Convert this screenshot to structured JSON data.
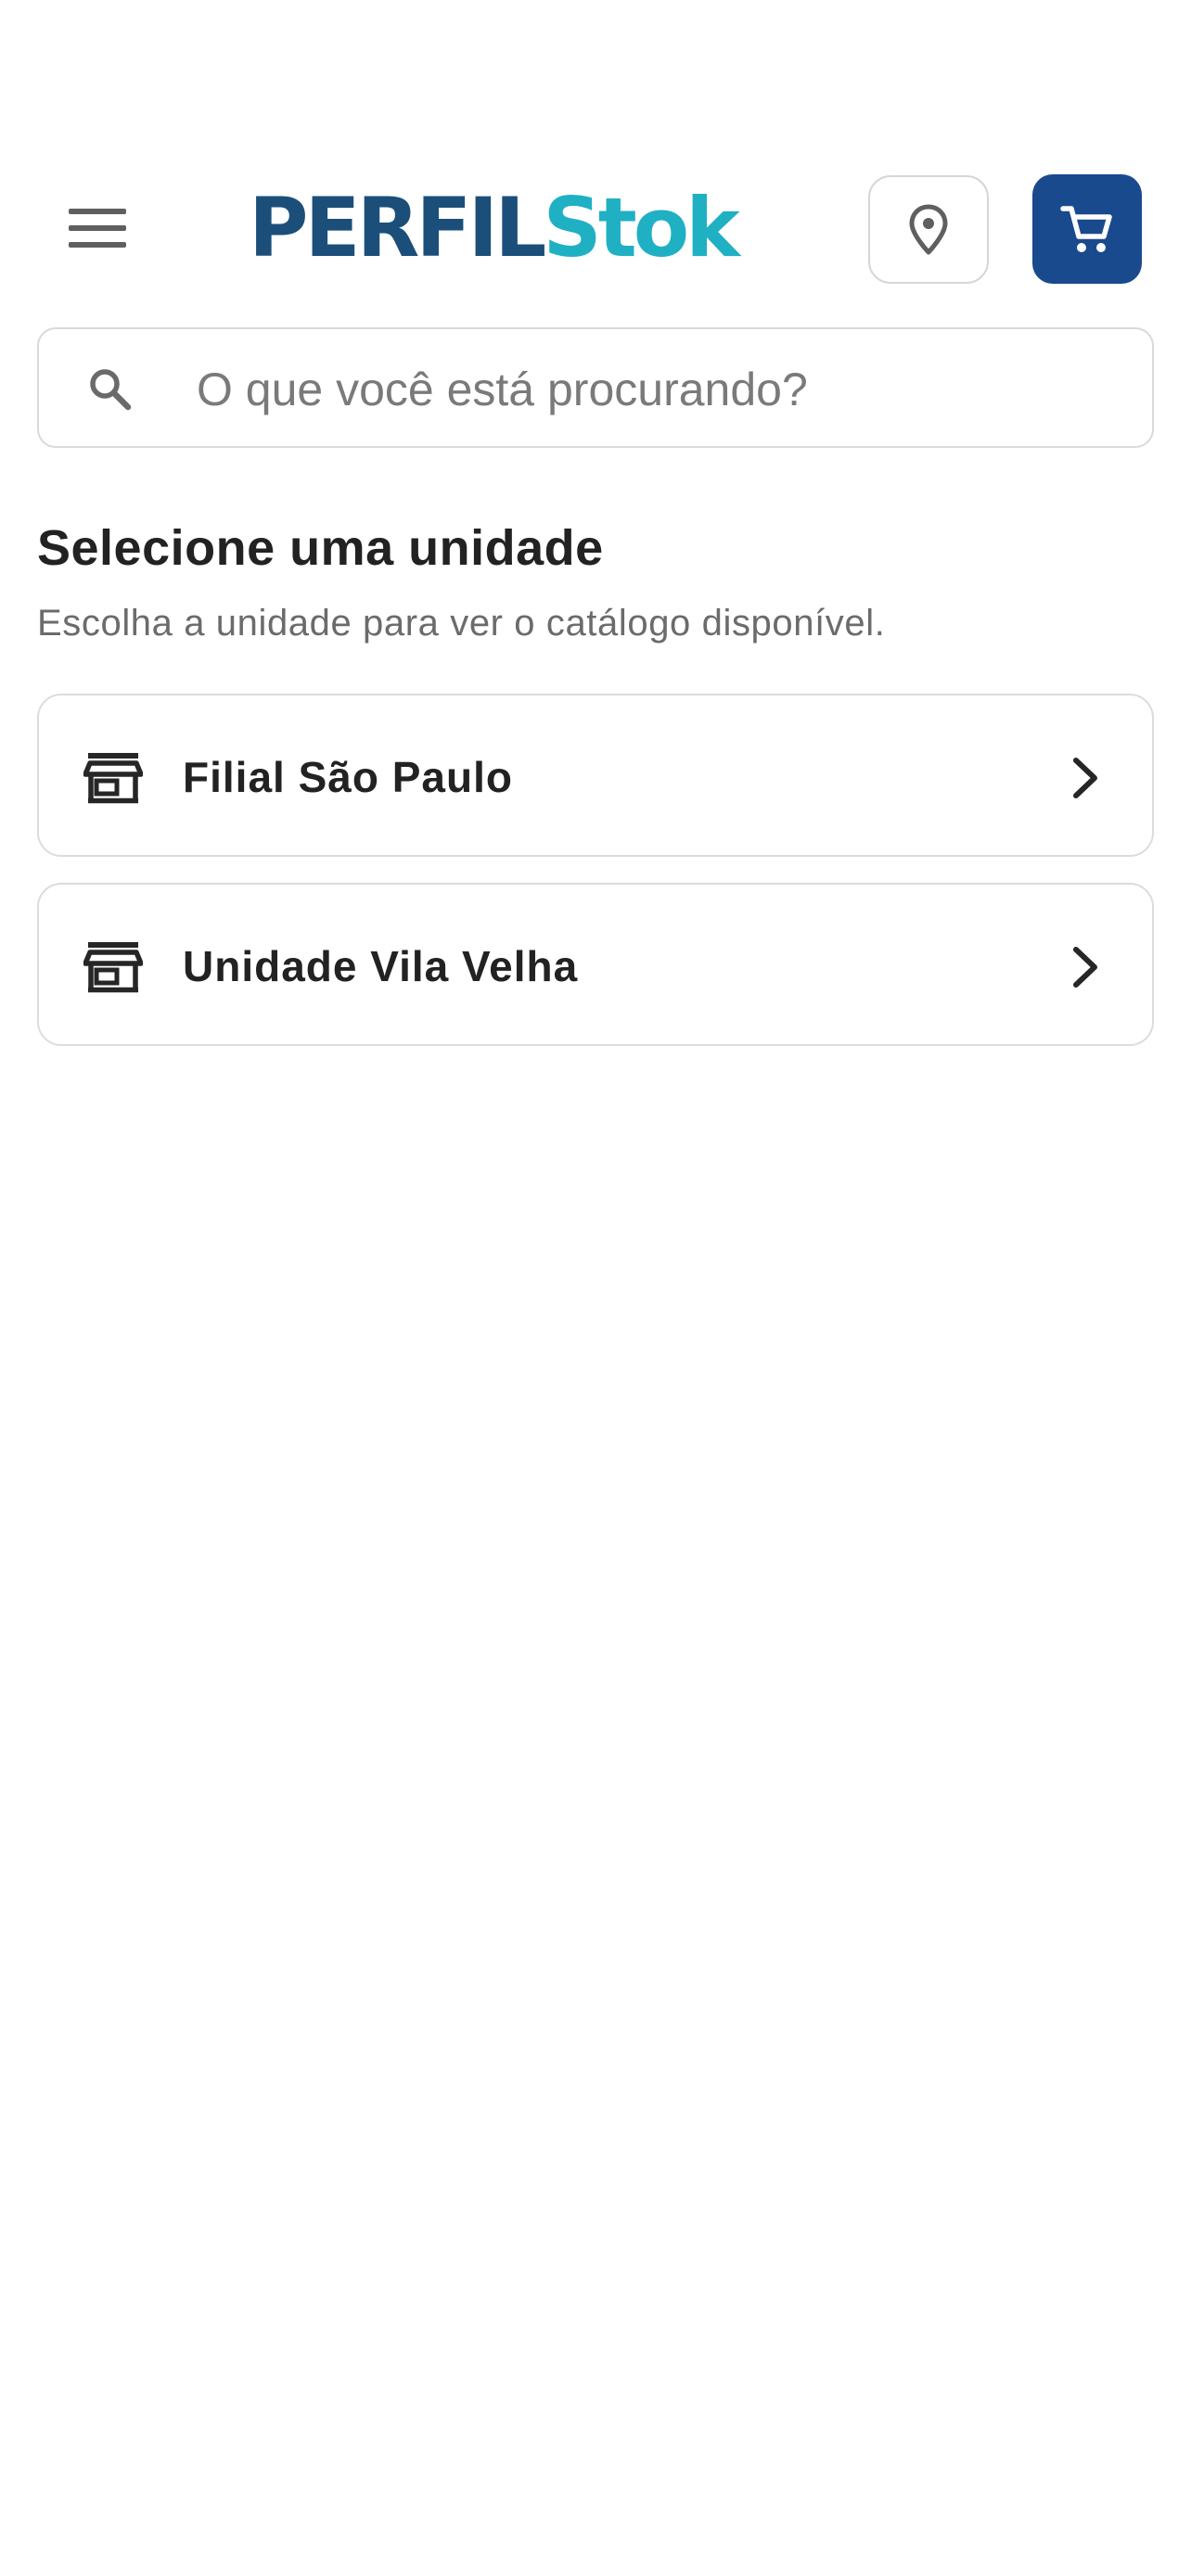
{
  "colors": {
    "brand_dark": "#1b4f7a",
    "brand_light": "#1fb0c4",
    "accent": "#1a4a8e",
    "icon_gray": "#5f5f5f"
  },
  "header": {
    "logo": {
      "part1": "PERFIL",
      "part2": "Stok"
    },
    "menu_icon": "hamburger-menu-icon",
    "location_icon": "map-pin-icon",
    "cart_icon": "shopping-cart-icon"
  },
  "search": {
    "placeholder": "O que você está procurando?",
    "value": "",
    "icon": "search-icon"
  },
  "section": {
    "title": "Selecione uma unidade",
    "subtitle": "Escolha a unidade para ver o catálogo disponível."
  },
  "units": [
    {
      "label": "Filial São Paulo",
      "icon": "store-icon"
    },
    {
      "label": "Unidade Vila Velha",
      "icon": "store-icon"
    }
  ]
}
